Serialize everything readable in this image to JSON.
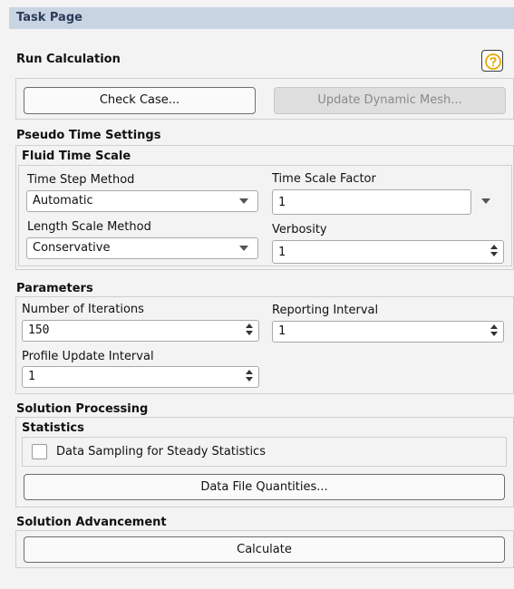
{
  "panel": {
    "title": "Task Page"
  },
  "run_calculation": {
    "title": "Run Calculation"
  },
  "buttons": {
    "check_case": "Check Case...",
    "update_dynamic_mesh": "Update Dynamic Mesh..."
  },
  "pseudo_time": {
    "title": "Pseudo Time Settings",
    "fluid_time_scale": {
      "title": "Fluid Time Scale",
      "time_step_method": {
        "label": "Time Step Method",
        "value": "Automatic"
      },
      "time_scale_factor": {
        "label": "Time Scale Factor",
        "value": "1"
      },
      "length_scale_method": {
        "label": "Length Scale Method",
        "value": "Conservative"
      },
      "verbosity": {
        "label": "Verbosity",
        "value": "1"
      }
    }
  },
  "parameters": {
    "title": "Parameters",
    "iterations": {
      "label": "Number of Iterations",
      "value": "150"
    },
    "reporting_interval": {
      "label": "Reporting Interval",
      "value": "1"
    },
    "profile_update_interval": {
      "label": "Profile Update Interval",
      "value": "1"
    }
  },
  "solution_processing": {
    "title": "Solution Processing",
    "statistics": {
      "title": "Statistics",
      "data_sampling": {
        "label": "Data Sampling for Steady Statistics",
        "checked": false
      }
    },
    "data_file_quantities": "Data File Quantities..."
  },
  "solution_advancement": {
    "title": "Solution Advancement",
    "calculate": "Calculate"
  },
  "icons": {
    "help": "help-icon",
    "dropdown": "chevron-down-icon",
    "spinner": "spinner-arrows-icon"
  },
  "colors": {
    "title_bar": "#c9d4e3",
    "background": "#f3f3f3",
    "help_icon": "#e5a800"
  }
}
